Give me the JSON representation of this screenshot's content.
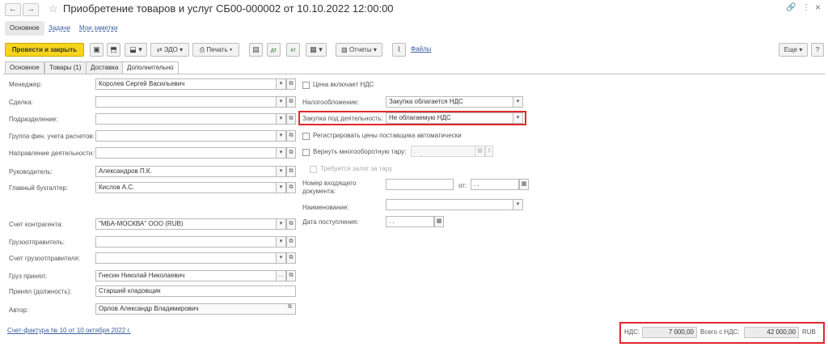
{
  "window": {
    "title": "Приобретение товаров и услуг СБ00-000002 от 10.10.2022 12:00:00",
    "back_icon": "←",
    "forward_icon": "→",
    "star_icon": "☆",
    "link_icon": "🔗",
    "menu_icon": "⋮",
    "close_icon": "×"
  },
  "nav_tabs": {
    "main": "Основное",
    "tasks": "Задачи",
    "my_notes": "Мои заметки"
  },
  "toolbar": {
    "post_close": "Провести и закрыть",
    "edo": "ЭДО",
    "print": "Печать",
    "reports": "Отчеты",
    "files": "Файлы",
    "more": "Еще",
    "help": "?"
  },
  "form_tabs": {
    "main": "Основное",
    "goods": "Товары (1)",
    "delivery": "Доставка",
    "additional": "Дополнительно"
  },
  "left": {
    "manager_label": "Менеджер:",
    "manager_value": "Королев Сергей Васильевич",
    "deal_label": "Сделка:",
    "deal_value": "",
    "division_label": "Подразделение:",
    "division_value": "",
    "fin_group_label": "Группа фин. учета расчетов:",
    "fin_group_value": "",
    "direction_label": "Направление деятельности:",
    "direction_value": "",
    "head_label": "Руководитель:",
    "head_value": "Александров П.К.",
    "chief_acc_label": "Главный бухгалтер:",
    "chief_acc_value": "Кислов А.С.",
    "counterparty_acc_label": "Счет контрагента:",
    "counterparty_acc_value": "\"МБА-МОСКВА\" ООО (RUB)",
    "shipper_label": "Грузоотправитель:",
    "shipper_value": "",
    "shipper_acc_label": "Счет грузоотправителя:",
    "shipper_acc_value": "",
    "received_label": "Груз принял:",
    "received_value": "Гнесин Николай Николаевич",
    "position_label": "Принял (должность):",
    "position_value": "Старший кладовщик",
    "author_label": "Автор:",
    "author_value": "Орлов Александр Владимирович"
  },
  "right": {
    "price_incl_vat": "Цена включает НДС",
    "taxation_label": "Налогообложение:",
    "taxation_value": "Закупка облагается НДС",
    "purchase_under_label": "Закупка под деятельность:",
    "purchase_under_value": "Не облагаемую НДС",
    "register_prices": "Регистрировать цены поставщика автоматически",
    "return_tare_label": "Вернуть многооборотную тару:",
    "return_tare_date": ". .",
    "deposit_required": "Требуется залог за тару",
    "incoming_doc_label": "Номер входящего документа:",
    "incoming_doc_value": "",
    "from_label": "от:",
    "from_value": ". .",
    "name_label": "Наименование:",
    "name_value": "",
    "receipt_date_label": "Дата поступления:",
    "receipt_date_value": ". ."
  },
  "footer": {
    "invoice_link": "Счет-фактура № 10 от 10 октября 2022 г.",
    "vat_label": "НДС:",
    "vat_value": "7 000,00",
    "total_label": "Всего с НДС:",
    "total_value": "42 000,00",
    "currency": "RUB"
  },
  "colors": {
    "accent_yellow": "#f7d41c",
    "highlight_red": "#e0282e",
    "link_blue": "#3a5fa0"
  }
}
